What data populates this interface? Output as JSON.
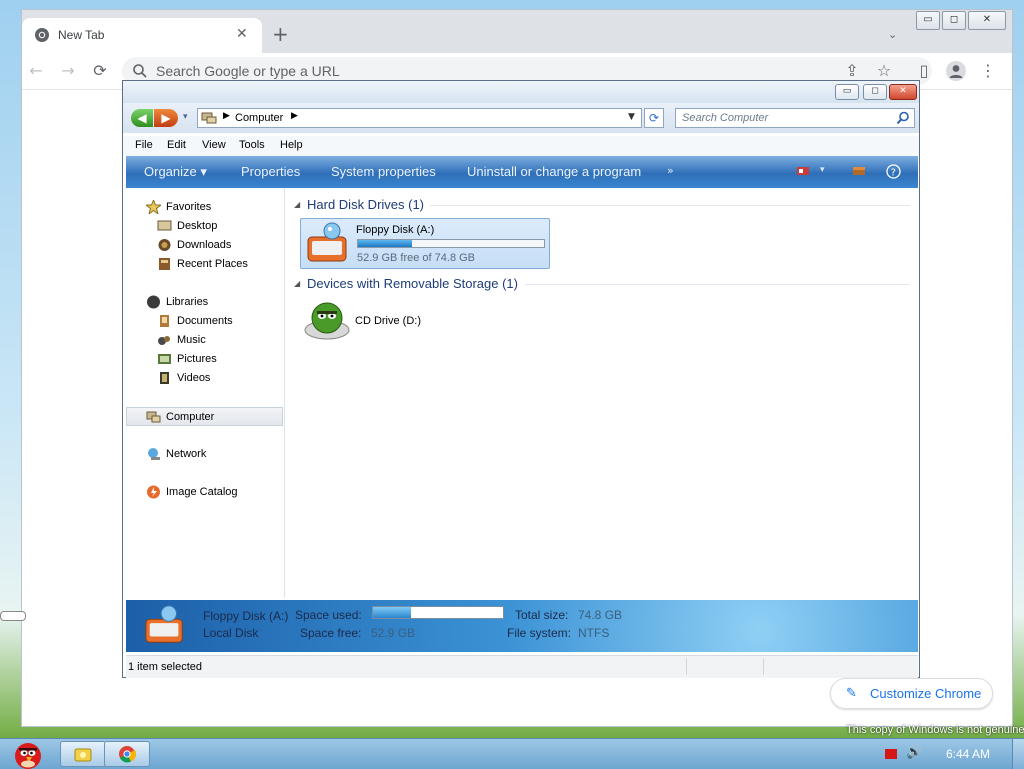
{
  "chrome": {
    "tab_title": "New Tab",
    "tab_close": "✕",
    "new_tab": "+",
    "tab_search": "⌄",
    "win_min": "▭",
    "win_max": "◻",
    "win_close": "✕",
    "toolbar": {
      "back": "←",
      "forward": "→",
      "reload": "⟳",
      "share": "⇪",
      "bookmark": "☆",
      "sidepanel": "▯",
      "menu": "⋮"
    },
    "omnibox_placeholder": "Search Google or type a URL",
    "customize_label": "Customize Chrome",
    "customize_icon": "pencil-icon"
  },
  "explorer": {
    "title_buttons": {
      "min": "▭",
      "max": "◻",
      "close": "✕"
    },
    "address": {
      "location": "Computer",
      "sep": "▶",
      "dropdown": "▼"
    },
    "refresh": "⟳",
    "search_placeholder": "Search Computer",
    "menu": [
      "File",
      "Edit",
      "View",
      "Tools",
      "Help"
    ],
    "commands": {
      "organize": "Organize ▾",
      "properties": "Properties",
      "system_properties": "System properties",
      "uninstall": "Uninstall or change a program",
      "more": "»"
    },
    "nav": {
      "favorites": {
        "label": "Favorites",
        "items": [
          "Desktop",
          "Downloads",
          "Recent Places"
        ]
      },
      "libraries": {
        "label": "Libraries",
        "items": [
          "Documents",
          "Music",
          "Pictures",
          "Videos"
        ]
      },
      "computer": "Computer",
      "network": "Network",
      "image_catalog": "Image Catalog"
    },
    "groups": {
      "hdd": "Hard Disk Drives (1)",
      "removable": "Devices with Removable Storage (1)"
    },
    "drives": {
      "a": {
        "name": "Floppy Disk (A:)",
        "free_text": "52.9 GB free of 74.8 GB",
        "used_fraction": 0.29
      },
      "d": {
        "name": "CD Drive (D:)"
      }
    },
    "details": {
      "name": "Floppy Disk (A:)",
      "type": "Local Disk",
      "space_used_label": "Space used:",
      "space_free_label": "Space free:",
      "space_free_value": "52.9 GB",
      "total_size_label": "Total size:",
      "total_size_value": "74.8 GB",
      "fs_label": "File system:",
      "fs_value": "NTFS"
    },
    "status": "1 item selected"
  },
  "os": {
    "genuine_notice": "This copy of Windows is not genuine",
    "clock": "6:44 AM"
  },
  "colors": {
    "accent": "#1a73e8",
    "cmdbar": "#2f6fb8",
    "selection": "#c6def6"
  }
}
